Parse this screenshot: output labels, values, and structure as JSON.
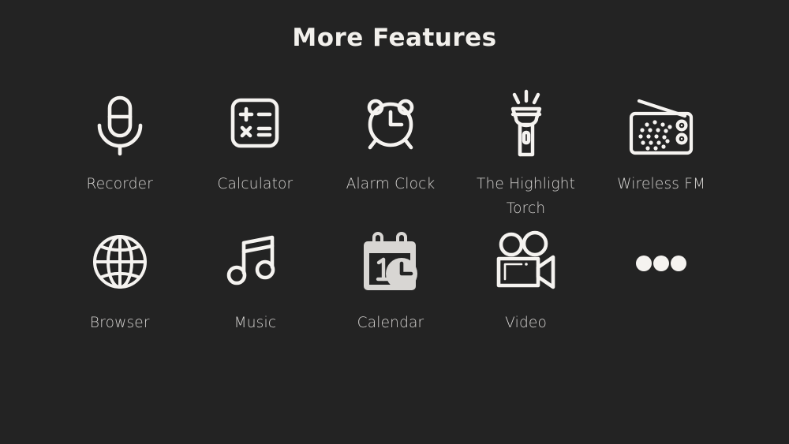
{
  "header": {
    "title": "More Features"
  },
  "colors": {
    "background": "#232323",
    "title_text": "#f2f0ec",
    "label_text": "#d6d4d2",
    "icon_stroke": "#f5f3f0"
  },
  "features": {
    "rows": [
      {
        "items": [
          {
            "label": "Recorder",
            "icon": "microphone-icon"
          },
          {
            "label": "Calculator",
            "icon": "calculator-icon"
          },
          {
            "label": "Alarm Clock",
            "icon": "alarm-clock-icon"
          },
          {
            "label": "The Highlight Torch",
            "icon": "flashlight-icon"
          },
          {
            "label": "Wireless FM",
            "icon": "radio-icon"
          }
        ]
      },
      {
        "items": [
          {
            "label": "Browser",
            "icon": "globe-icon"
          },
          {
            "label": "Music",
            "icon": "music-note-icon"
          },
          {
            "label": "Calendar",
            "icon": "calendar-clock-icon"
          },
          {
            "label": "Video",
            "icon": "video-camera-icon"
          },
          {
            "label": "",
            "icon": "more-dots-icon"
          }
        ]
      }
    ]
  }
}
